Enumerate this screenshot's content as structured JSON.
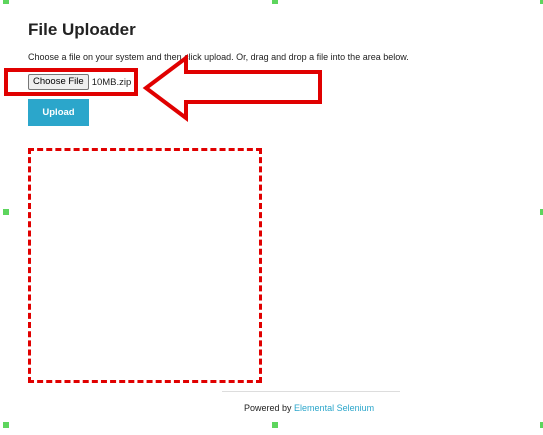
{
  "page": {
    "title": "File Uploader",
    "instructions": "Choose a file on your system and then click upload. Or, drag and drop a file into the area below."
  },
  "file_input": {
    "button_label": "Choose File",
    "selected_file": "10MB.zip"
  },
  "upload_button": {
    "label": "Upload"
  },
  "footer": {
    "powered_by": "Powered by",
    "link_text": "Elemental Selenium"
  },
  "colors": {
    "accent": "#2ba6cb",
    "annotation": "#e00000",
    "handle": "#5dd55d"
  }
}
